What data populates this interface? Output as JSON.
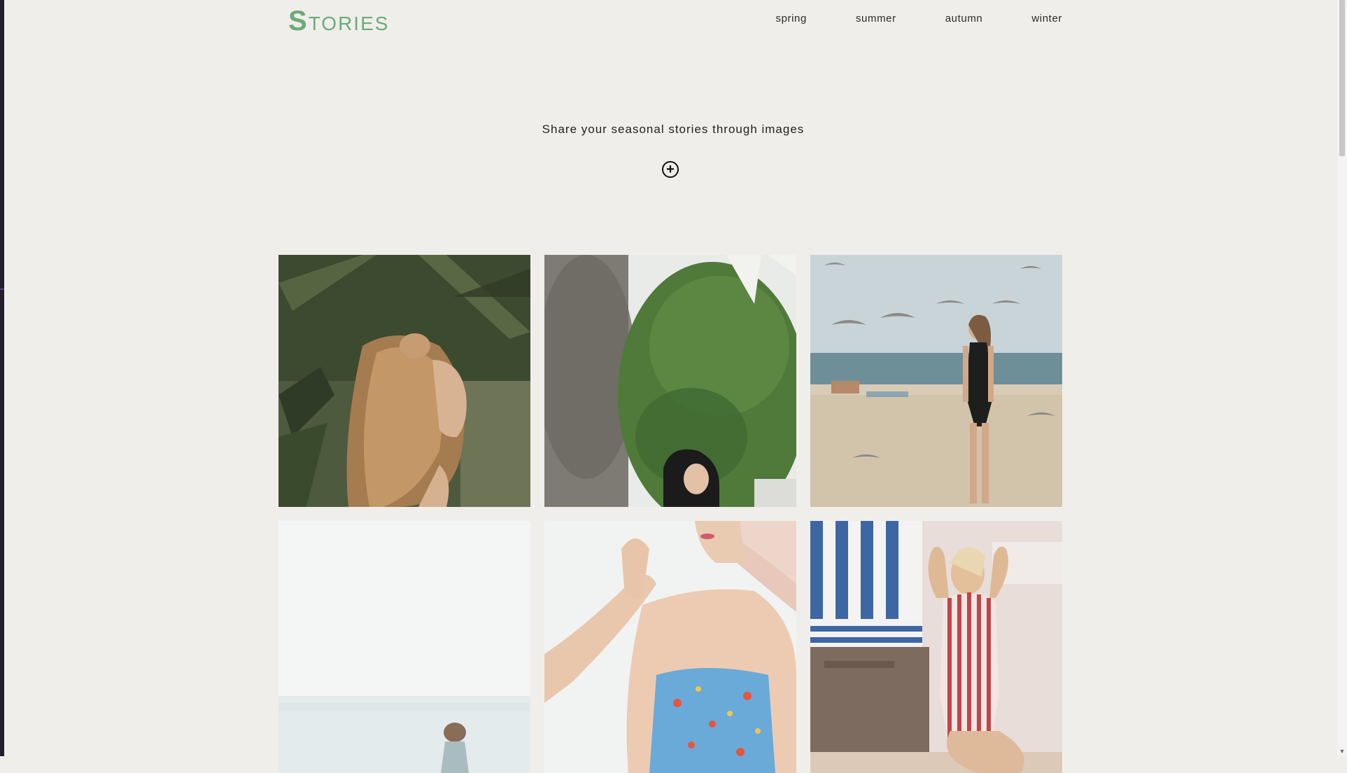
{
  "header": {
    "logo_cap": "S",
    "logo_rest": "tories",
    "nav": [
      {
        "label": "spring"
      },
      {
        "label": "summer"
      },
      {
        "label": "autumn"
      },
      {
        "label": "winter"
      }
    ]
  },
  "hero": {
    "tagline": "Share your seasonal stories through images",
    "add_icon": "plus-circle-icon",
    "add_glyph": "+"
  },
  "gallery": [
    {
      "subject": "woman-with-wavy-hair-among-palm-leaves"
    },
    {
      "subject": "girl-under-green-tree"
    },
    {
      "subject": "woman-black-swimsuit-beach-seagulls"
    },
    {
      "subject": "person-on-misty-beach"
    },
    {
      "subject": "woman-floral-dress-sun-hat"
    },
    {
      "subject": "woman-striped-swimsuit-beach-chair"
    }
  ],
  "colors": {
    "background": "#f0eeeb",
    "accent": "#6aab78",
    "text": "#222222"
  },
  "scrollbar": {
    "up_glyph": "▲",
    "down_glyph": "▼"
  }
}
